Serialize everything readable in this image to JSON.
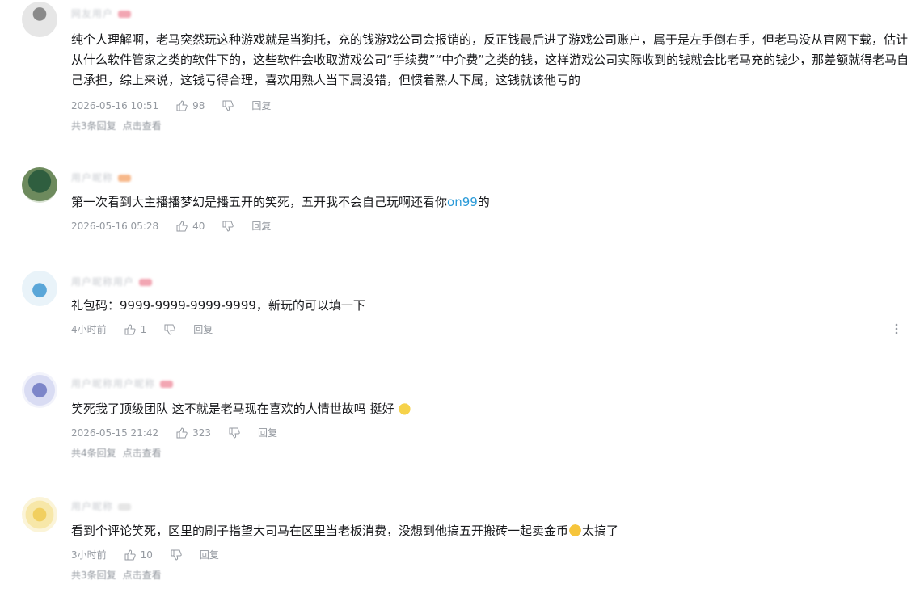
{
  "comments": [
    {
      "name": "网友用户",
      "text": "纯个人理解啊，老马突然玩这种游戏就是当狗托，充的钱游戏公司会报销的，反正钱最后进了游戏公司账户，属于是左手倒右手，但老马没从官网下载，估计从什么软件管家之类的软件下的，这些软件会收取游戏公司“手续费”“中介费”之类的钱，这样游戏公司实际收到的钱就会比老马充的钱少，那差额就得老马自己承担，综上来说，这钱亏得合理，喜欢用熟人当下属没错，但惯着熟人下属，这钱就该他亏的",
      "time": "2026-05-16 10:51",
      "likes": "98",
      "reply": "回复",
      "replies_count": "共3条回复",
      "replies_action": "点击查看"
    },
    {
      "name": "用户昵称",
      "text_before": "第一次看到大主播播梦幻是播五开的笑死，五开我不会自己玩啊还看你",
      "text_link": "on99",
      "text_after": "的",
      "time": "2026-05-16 05:28",
      "likes": "40",
      "reply": "回复"
    },
    {
      "name": "用户昵称用户",
      "text": "礼包码：9999-9999-9999-9999，新玩的可以填一下",
      "time": "4小时前",
      "likes": "1",
      "reply": "回复"
    },
    {
      "name": "用户昵称用户昵称",
      "text": "笑死我了顶级团队 这不就是老马现在喜欢的人情世故吗 挺好",
      "time": "2026-05-15 21:42",
      "likes": "323",
      "reply": "回复",
      "replies_count": "共4条回复",
      "replies_action": "点击查看"
    },
    {
      "name": "用户昵称",
      "text_before": "看到个评论笑死，区里的刷子指望大司马在区里当老板消费，没想到他搞五开搬砖一起卖金币",
      "text_after": "太搞了",
      "time": "3小时前",
      "likes": "10",
      "reply": "回复",
      "replies_count": "共3条回复",
      "replies_action": "点击查看"
    }
  ],
  "colors": {
    "text": "#18191c",
    "meta": "#9499a0",
    "link": "#2a9ad8",
    "badge": "#f2a6b3"
  },
  "icons": [
    "like-icon",
    "dislike-icon",
    "more-icon",
    "emoji-cat-icon",
    "emoji-laugh-icon"
  ]
}
